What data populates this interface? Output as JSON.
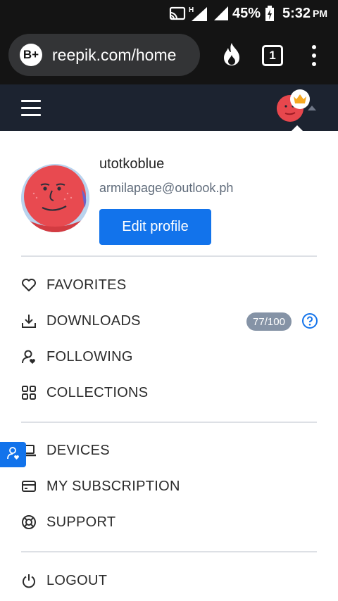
{
  "status_bar": {
    "battery_percent": "45%",
    "time": "5:32",
    "time_suffix": "PM",
    "network_label": "H"
  },
  "browser": {
    "site_badge": "B+",
    "url": "reepik.com/home",
    "tab_count": "1"
  },
  "profile": {
    "username": "utotkoblue",
    "email": "armilapage@outlook.ph",
    "edit_label": "Edit profile"
  },
  "menu": {
    "favorites": "FAVORITES",
    "downloads": "DOWNLOADS",
    "downloads_quota": "77/100",
    "following": "FOLLOWING",
    "collections": "COLLECTIONS",
    "devices": "DEVICES",
    "subscription": "MY SUBSCRIPTION",
    "support": "SUPPORT",
    "logout": "LOGOUT"
  },
  "colors": {
    "accent": "#1273eb",
    "header_bg": "#1c2330",
    "quota_badge": "#8593a6",
    "premium_crown": "#f6a821"
  }
}
